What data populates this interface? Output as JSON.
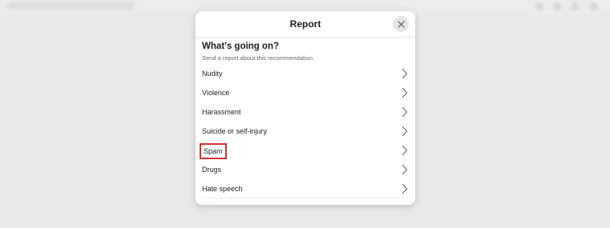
{
  "dialog": {
    "title": "Report",
    "heading": "What's going on?",
    "subheading": "Send a report about this recommendation.",
    "close_icon": "close-icon"
  },
  "options": [
    {
      "label": "Nudity"
    },
    {
      "label": "Violence"
    },
    {
      "label": "Harassment"
    },
    {
      "label": "Suicide or self-injury"
    },
    {
      "label": "Spam"
    },
    {
      "label": "Drugs"
    },
    {
      "label": "Hate speech"
    }
  ],
  "highlight_color": "#d32f2f",
  "chevron_icon": "chevron-right-icon"
}
